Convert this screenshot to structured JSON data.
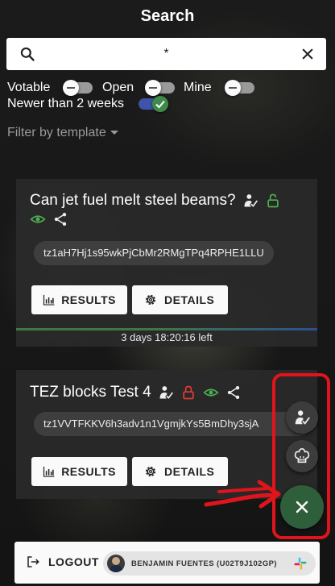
{
  "title": "Search",
  "search": {
    "value": "*",
    "icon": "search-icon",
    "clear_icon": "close-icon"
  },
  "filters": {
    "votable": {
      "label": "Votable",
      "on": false
    },
    "open": {
      "label": "Open",
      "on": false
    },
    "mine": {
      "label": "Mine",
      "on": false
    },
    "newer": {
      "label": "Newer than 2 weeks",
      "on": true
    }
  },
  "template_filter": {
    "label": "Filter by template"
  },
  "polls": [
    {
      "title": "Can jet fuel melt steel beams?",
      "address": "tz1aH7Hj1s95wkPjCbMr2RMgTPq4RPHE1LLU",
      "results_label": "RESULTS",
      "details_label": "DETAILS",
      "time_left": "3 days 18:20:16 left",
      "lock_color": "#4caf50"
    },
    {
      "title": "TEZ blocks Test 4",
      "address": "tz1VVTFKKV6h3adv1n1VgmjkYs5BmDhy3sjA",
      "results_label": "RESULTS",
      "details_label": "DETAILS",
      "lock_color": "#e53935"
    }
  ],
  "footer": {
    "logout_label": "LOGOUT",
    "user_label": "BENJAMIN FUENTES (U02T9J102GP)"
  },
  "colors": {
    "accent": "#2f5e3a",
    "highlight": "#e0141b",
    "toggle_on": "#3d54a8"
  }
}
